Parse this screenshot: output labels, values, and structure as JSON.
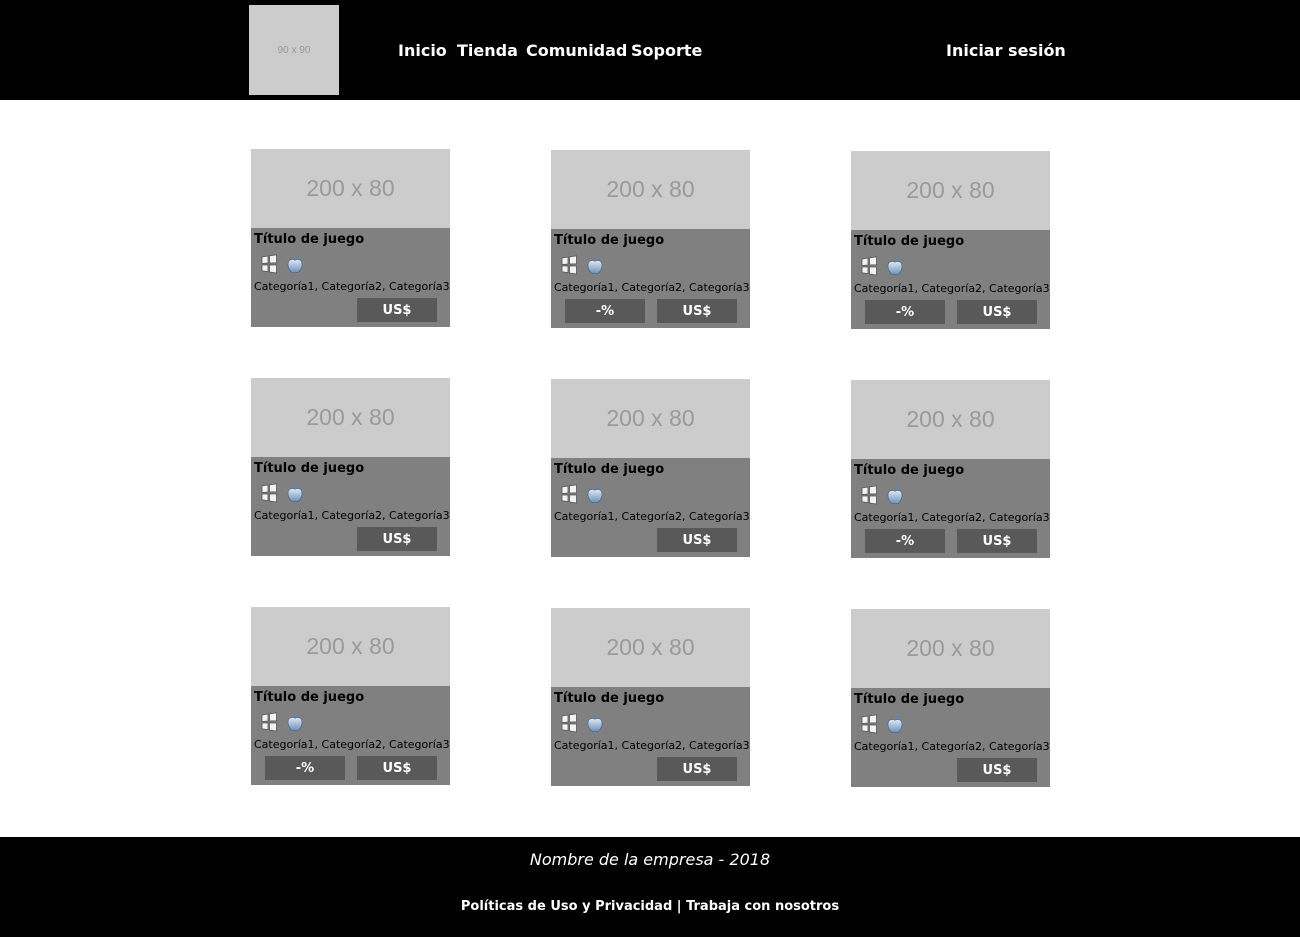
{
  "header": {
    "logo_text": "90 x 90",
    "nav": [
      "Inicio",
      "Tienda",
      "Comunidad",
      "Soporte"
    ],
    "login": "Iniciar sesión"
  },
  "cards": [
    {
      "image": "200 x 80",
      "title": "Título de juego",
      "platforms": [
        "windows-icon",
        "apple-icon"
      ],
      "categories": "Categoría1, Categoría2, Categoría3",
      "discount": "",
      "price": "US$"
    },
    {
      "image": "200 x 80",
      "title": "Título de juego",
      "platforms": [
        "windows-icon",
        "apple-icon"
      ],
      "categories": "Categoría1, Categoría2, Categoría3",
      "discount": "-%",
      "price": "US$"
    },
    {
      "image": "200 x 80",
      "title": "Título de juego",
      "platforms": [
        "windows-icon",
        "apple-icon"
      ],
      "categories": "Categoría1, Categoría2, Categoría3",
      "discount": "-%",
      "price": "US$"
    },
    {
      "image": "200 x 80",
      "title": "Título de juego",
      "platforms": [
        "windows-icon",
        "apple-icon"
      ],
      "categories": "Categoría1, Categoría2, Categoría3",
      "discount": "",
      "price": "US$"
    },
    {
      "image": "200 x 80",
      "title": "Título de juego",
      "platforms": [
        "windows-icon",
        "apple-icon"
      ],
      "categories": "Categoría1, Categoría2, Categoría3",
      "discount": "",
      "price": "US$"
    },
    {
      "image": "200 x 80",
      "title": "Título de juego",
      "platforms": [
        "windows-icon",
        "apple-icon"
      ],
      "categories": "Categoría1, Categoría2, Categoría3",
      "discount": "-%",
      "price": "US$"
    },
    {
      "image": "200 x 80",
      "title": "Título de juego",
      "platforms": [
        "windows-icon",
        "apple-icon"
      ],
      "categories": "Categoría1, Categoría2, Categoría3",
      "discount": "-%",
      "price": "US$"
    },
    {
      "image": "200 x 80",
      "title": "Título de juego",
      "platforms": [
        "windows-icon",
        "apple-icon"
      ],
      "categories": "Categoría1, Categoría2, Categoría3",
      "discount": "",
      "price": "US$"
    },
    {
      "image": "200 x 80",
      "title": "Título de juego",
      "platforms": [
        "windows-icon",
        "apple-icon"
      ],
      "categories": "Categoría1, Categoría2, Categoría3",
      "discount": "",
      "price": "US$"
    }
  ],
  "footer": {
    "company": "Nombre de la empresa - 2018",
    "links": [
      "Políticas de Uso y Privacidad",
      "Trabaja con nosotros"
    ],
    "separator": "|"
  },
  "colors": {
    "header_bg": "#000000",
    "card_bg": "#808080",
    "placeholder_bg": "#cccccc",
    "button_bg": "#595959"
  }
}
